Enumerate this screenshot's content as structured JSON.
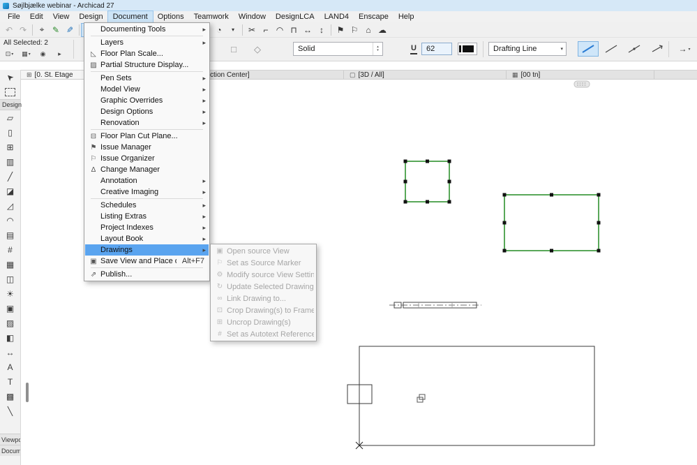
{
  "window": {
    "title": "Søjlbjælke webinar - Archicad 27"
  },
  "glyphs": {
    "submenu_arrow": "▸",
    "combo_arrow": "▾",
    "spinner_up": "▴",
    "spinner_down": "▾"
  },
  "colors": {
    "selection_green": "#228b22",
    "menu_highlight": "#5aa4ef",
    "active_blue_bg": "#cfe6f9",
    "line_accent": "#2b7cd3"
  },
  "menubar": {
    "items": [
      {
        "label": "File"
      },
      {
        "label": "Edit"
      },
      {
        "label": "View"
      },
      {
        "label": "Design"
      },
      {
        "label": "Document",
        "open": true
      },
      {
        "label": "Options"
      },
      {
        "label": "Teamwork"
      },
      {
        "label": "Window"
      },
      {
        "label": "DesignLCA"
      },
      {
        "label": "LAND4"
      },
      {
        "label": "Enscape"
      },
      {
        "label": "Help"
      }
    ]
  },
  "toolbar": {
    "icons": [
      {
        "name": "undo-icon",
        "glyph": "↶",
        "style": "color:#a8a8a8"
      },
      {
        "name": "redo-icon",
        "glyph": "↷",
        "style": "color:#a8a8a8"
      },
      {
        "sep": true
      },
      {
        "name": "search-and-select-icon",
        "glyph": "⌖"
      },
      {
        "name": "pick-up-parameters-icon",
        "glyph": "✎",
        "style": "color:#2e8b2e"
      },
      {
        "name": "inject-parameters-icon",
        "glyph": "✎",
        "style": "color:#1d6fb8;display:inline-block;transform:scaleX(-1)"
      },
      {
        "sep": true
      },
      {
        "name": "arrow-tool-icon",
        "glyph": "➤",
        "active": true,
        "style": "display:inline-block;transform:rotate(-135deg);color:#1d5c9e"
      },
      {
        "name": "marquee-tool-icon",
        "glyph": "⊡"
      },
      {
        "sep": true
      },
      {
        "name": "drag-icon",
        "glyph": "+"
      },
      {
        "name": "rotate-icon",
        "glyph": "↻"
      },
      {
        "name": "mirror-icon",
        "glyph": "◫"
      },
      {
        "name": "align-icon",
        "glyph": "≡"
      },
      {
        "name": "guide-lines-icon",
        "glyph": "▦",
        "style": "color:#1d6fb8"
      },
      {
        "name": "snap-grid-icon",
        "glyph": "⊞"
      },
      {
        "name": "snap-options-arrow-icon",
        "glyph": "▾",
        "style": "font-size:8px"
      },
      {
        "name": "autosave-clock-icon",
        "glyph": "◔"
      },
      {
        "name": "more-options-arrow-icon",
        "glyph": "▾",
        "style": "font-size:8px"
      },
      {
        "sep": true
      },
      {
        "name": "split-icon",
        "glyph": "✂"
      },
      {
        "name": "adjust-icon",
        "glyph": "⌐"
      },
      {
        "name": "fillet-icon",
        "glyph": "◠"
      },
      {
        "name": "trim-icon",
        "glyph": "⊓"
      },
      {
        "name": "stretch-icon",
        "glyph": "↔"
      },
      {
        "name": "resize-icon",
        "glyph": "↕"
      },
      {
        "sep": true
      },
      {
        "name": "issue-flag-icon",
        "glyph": "⚑"
      },
      {
        "name": "issue-organizer-icon",
        "glyph": "⚐"
      },
      {
        "name": "favorites-icon",
        "glyph": "⌂"
      },
      {
        "name": "bimcloud-icon",
        "glyph": "☁"
      }
    ]
  },
  "document_menu": {
    "items": [
      {
        "label": "Documenting Tools",
        "submenu": true
      },
      {
        "sep": true
      },
      {
        "label": "Layers",
        "submenu": true
      },
      {
        "label": "Floor Plan Scale...",
        "icon": "◺"
      },
      {
        "label": "Partial Structure Display...",
        "icon": "▨"
      },
      {
        "sep": true
      },
      {
        "label": "Pen Sets",
        "submenu": true
      },
      {
        "label": "Model View",
        "submenu": true
      },
      {
        "label": "Graphic Overrides",
        "submenu": true
      },
      {
        "label": "Design Options",
        "submenu": true
      },
      {
        "label": "Renovation",
        "submenu": true
      },
      {
        "sep": true
      },
      {
        "label": "Floor Plan Cut Plane...",
        "icon": "⊟"
      },
      {
        "label": "Issue Manager",
        "icon": "⚑"
      },
      {
        "label": "Issue Organizer",
        "icon": "⚐"
      },
      {
        "label": "Change Manager",
        "icon": "Δ"
      },
      {
        "label": "Annotation",
        "submenu": true
      },
      {
        "label": "Creative Imaging",
        "submenu": true
      },
      {
        "sep": true
      },
      {
        "label": "Schedules",
        "submenu": true
      },
      {
        "label": "Listing Extras",
        "submenu": true
      },
      {
        "label": "Project Indexes",
        "submenu": true
      },
      {
        "label": "Layout Book",
        "submenu": true
      },
      {
        "label": "Drawings",
        "submenu": true,
        "highlighted": true
      },
      {
        "label": "Save View and Place on Layout",
        "shortcut": "Alt+F7",
        "icon": "▣"
      },
      {
        "sep": true
      },
      {
        "label": "Publish...",
        "icon": "⇗"
      }
    ]
  },
  "drawings_submenu": {
    "items": [
      {
        "label": "Open source View",
        "icon": "▣"
      },
      {
        "label": "Set as Source Marker",
        "icon": "⚐"
      },
      {
        "label": "Modify source View Settings...",
        "icon": "⚙"
      },
      {
        "label": "Update Selected Drawing(s)",
        "icon": "↻"
      },
      {
        "label": "Link Drawing to...",
        "icon": "∞"
      },
      {
        "label": "Crop Drawing(s) to Frame",
        "icon": "⊡"
      },
      {
        "label": "Uncrop Drawing(s)",
        "icon": "⊞"
      },
      {
        "label": "Set as Autotext Reference",
        "icon": "#"
      }
    ]
  },
  "infobar": {
    "selected_label": "All Selected: 2",
    "mini_buttons": [
      {
        "name": "tool-settings-button",
        "glyph": "⊡",
        "arrow": true
      },
      {
        "name": "favorites-button",
        "glyph": "▦",
        "arrow": true
      },
      {
        "name": "renovation-filter-button",
        "glyph": "◉"
      },
      {
        "name": "expand-infobox-button",
        "glyph": "▸"
      }
    ],
    "geometry_buttons": [
      {
        "name": "geometry-rectangle-button",
        "glyph": "□"
      },
      {
        "name": "geometry-rotated-rectangle-button",
        "glyph": "◇"
      }
    ],
    "fill_combo": {
      "value": "Solid"
    },
    "pen": {
      "icon_label": "U",
      "value": "62"
    },
    "line_type_combo": {
      "value": "Drafting Line"
    },
    "arrow_button": {
      "glyph": "→"
    }
  },
  "tabbar": {
    "tabs": [
      {
        "glyph": "⊞",
        "label": "[0. St. Etage",
        "active": true
      },
      {
        "label": "ction Center]"
      },
      {
        "glyph": "▢",
        "label": "[3D / All]"
      },
      {
        "glyph": "▦",
        "label": "[00 tn]"
      }
    ]
  },
  "toolbox": {
    "tools": [
      {
        "name": "select-arrow-tool",
        "glyph": "➤",
        "style": "display:inline-block;transform:rotate(-135deg)"
      },
      {
        "name": "marquee-tool",
        "marquee": true
      },
      {
        "header": "Design"
      },
      {
        "name": "wall-tool",
        "glyph": "▱"
      },
      {
        "name": "door-tool",
        "glyph": "▯"
      },
      {
        "name": "window-tool",
        "glyph": "⊞"
      },
      {
        "name": "column-tool",
        "glyph": "▥"
      },
      {
        "name": "beam-tool",
        "glyph": "╱"
      },
      {
        "name": "slab-tool",
        "glyph": "◪"
      },
      {
        "name": "roof-tool",
        "glyph": "◿"
      },
      {
        "name": "shell-tool",
        "glyph": "◠"
      },
      {
        "name": "stair-tool",
        "glyph": "▤"
      },
      {
        "name": "railing-tool",
        "glyph": "#"
      },
      {
        "name": "curtain-wall-tool",
        "glyph": "▦"
      },
      {
        "name": "object-tool",
        "glyph": "◫"
      },
      {
        "name": "lamp-tool",
        "glyph": "☀"
      },
      {
        "name": "zone-tool",
        "glyph": "▣"
      },
      {
        "name": "mesh-tool",
        "glyph": "▨"
      },
      {
        "name": "morph-tool",
        "glyph": "◧"
      },
      {
        "name": "dimension-tool",
        "glyph": "↔"
      },
      {
        "name": "text-tool",
        "glyph": "A"
      },
      {
        "name": "label-tool",
        "glyph": "T"
      },
      {
        "name": "fill-tool",
        "glyph": "▩"
      },
      {
        "name": "line-tool",
        "glyph": "╲"
      }
    ],
    "bottom_tabs": [
      "Viewpoi",
      "Docume"
    ]
  }
}
